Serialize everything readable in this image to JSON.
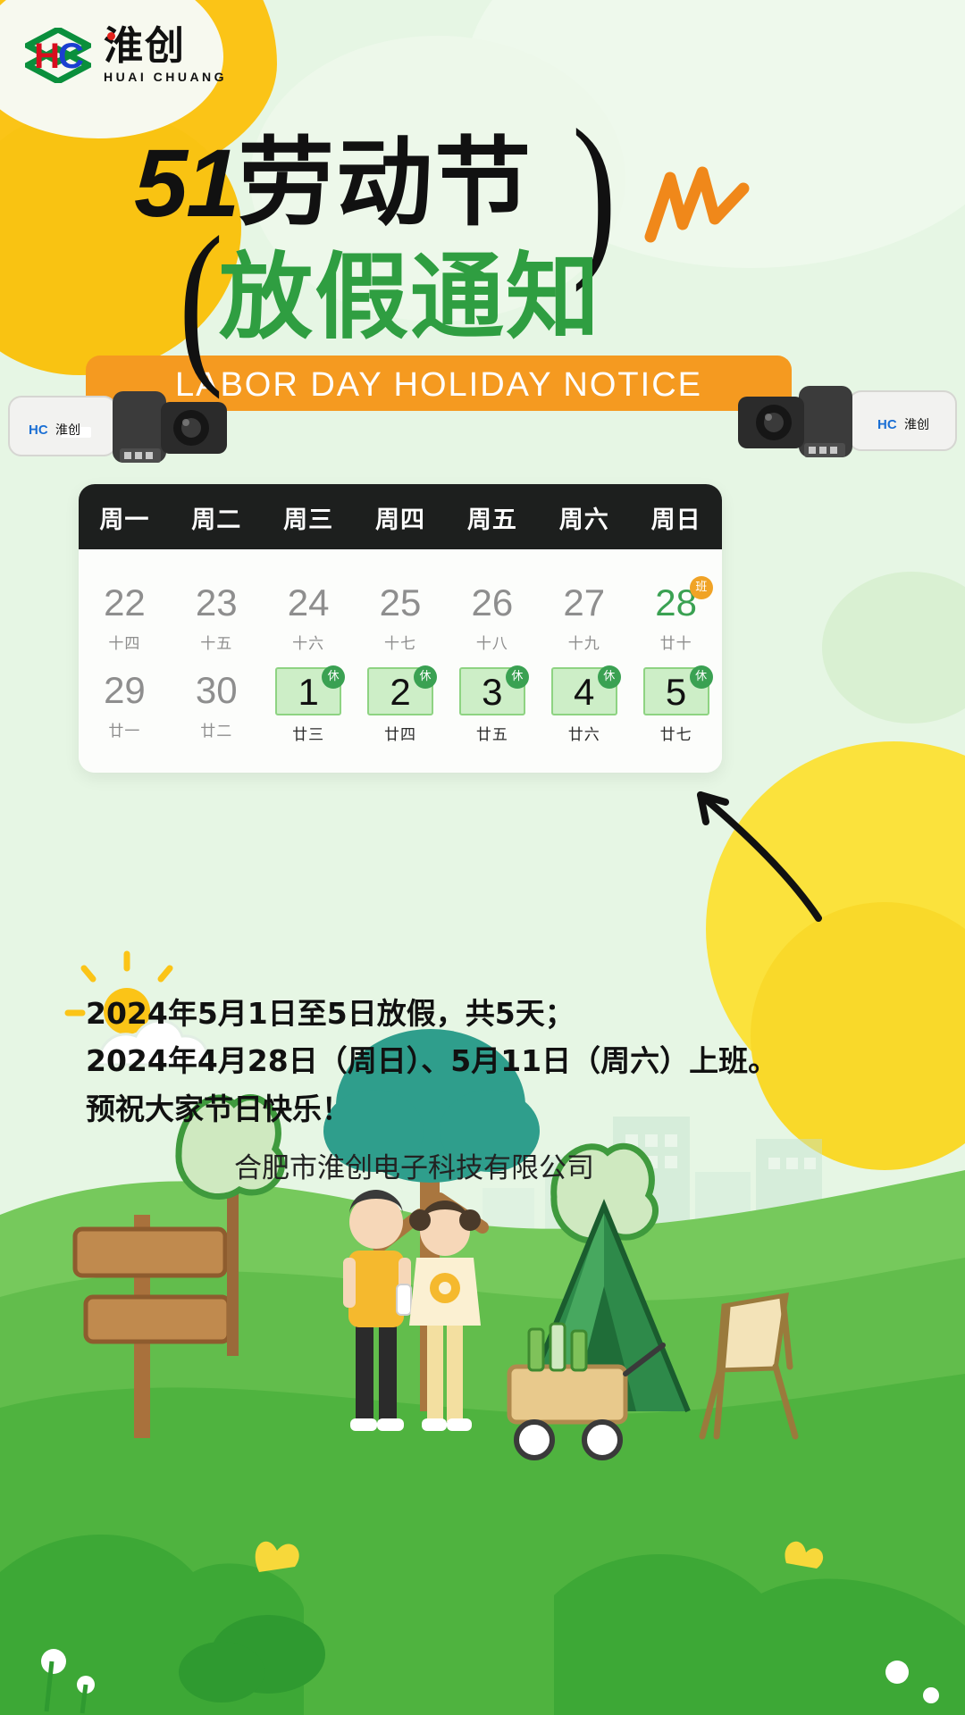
{
  "brand": {
    "logo_hc": "HC",
    "logo_cn": "淮创",
    "logo_en": "HUAI CHUANG"
  },
  "title": {
    "line1_number": "51",
    "line1_text": "劳动节",
    "line2": "放假通知",
    "banner_en": "LABOR DAY HOLIDAY NOTICE"
  },
  "calendar": {
    "weekdays": [
      "周一",
      "周二",
      "周三",
      "周四",
      "周五",
      "周六",
      "周日"
    ],
    "rows": [
      [
        {
          "day": "22",
          "lunar": "十四",
          "state": "normal",
          "badge": ""
        },
        {
          "day": "23",
          "lunar": "十五",
          "state": "normal",
          "badge": ""
        },
        {
          "day": "24",
          "lunar": "十六",
          "state": "normal",
          "badge": ""
        },
        {
          "day": "25",
          "lunar": "十七",
          "state": "normal",
          "badge": ""
        },
        {
          "day": "26",
          "lunar": "十八",
          "state": "normal",
          "badge": ""
        },
        {
          "day": "27",
          "lunar": "十九",
          "state": "normal",
          "badge": ""
        },
        {
          "day": "28",
          "lunar": "廿十",
          "state": "work",
          "badge": "班"
        }
      ],
      [
        {
          "day": "29",
          "lunar": "廿一",
          "state": "normal",
          "badge": ""
        },
        {
          "day": "30",
          "lunar": "廿二",
          "state": "normal",
          "badge": ""
        },
        {
          "day": "1",
          "lunar": "廿三",
          "state": "rest",
          "badge": "休"
        },
        {
          "day": "2",
          "lunar": "廿四",
          "state": "rest",
          "badge": "休"
        },
        {
          "day": "3",
          "lunar": "廿五",
          "state": "rest",
          "badge": "休"
        },
        {
          "day": "4",
          "lunar": "廿六",
          "state": "rest",
          "badge": "休"
        },
        {
          "day": "5",
          "lunar": "廿七",
          "state": "rest",
          "badge": "休"
        }
      ]
    ]
  },
  "notice": {
    "line1": "2024年5月1日至5日放假，共5天；",
    "line2": "2024年4月28日（周日）、5月11日（周六）上班。",
    "line3": "预祝大家节日快乐！",
    "company": "合肥市淮创电子科技有限公司"
  },
  "colors": {
    "background": "#e6f6e4",
    "accent_green": "#2f9e41",
    "accent_orange": "#f59a20",
    "accent_yellow": "#fbc417",
    "header_black": "#1d1f1e",
    "rest_fill": "#cdeec7",
    "rest_border": "#8ed382"
  }
}
